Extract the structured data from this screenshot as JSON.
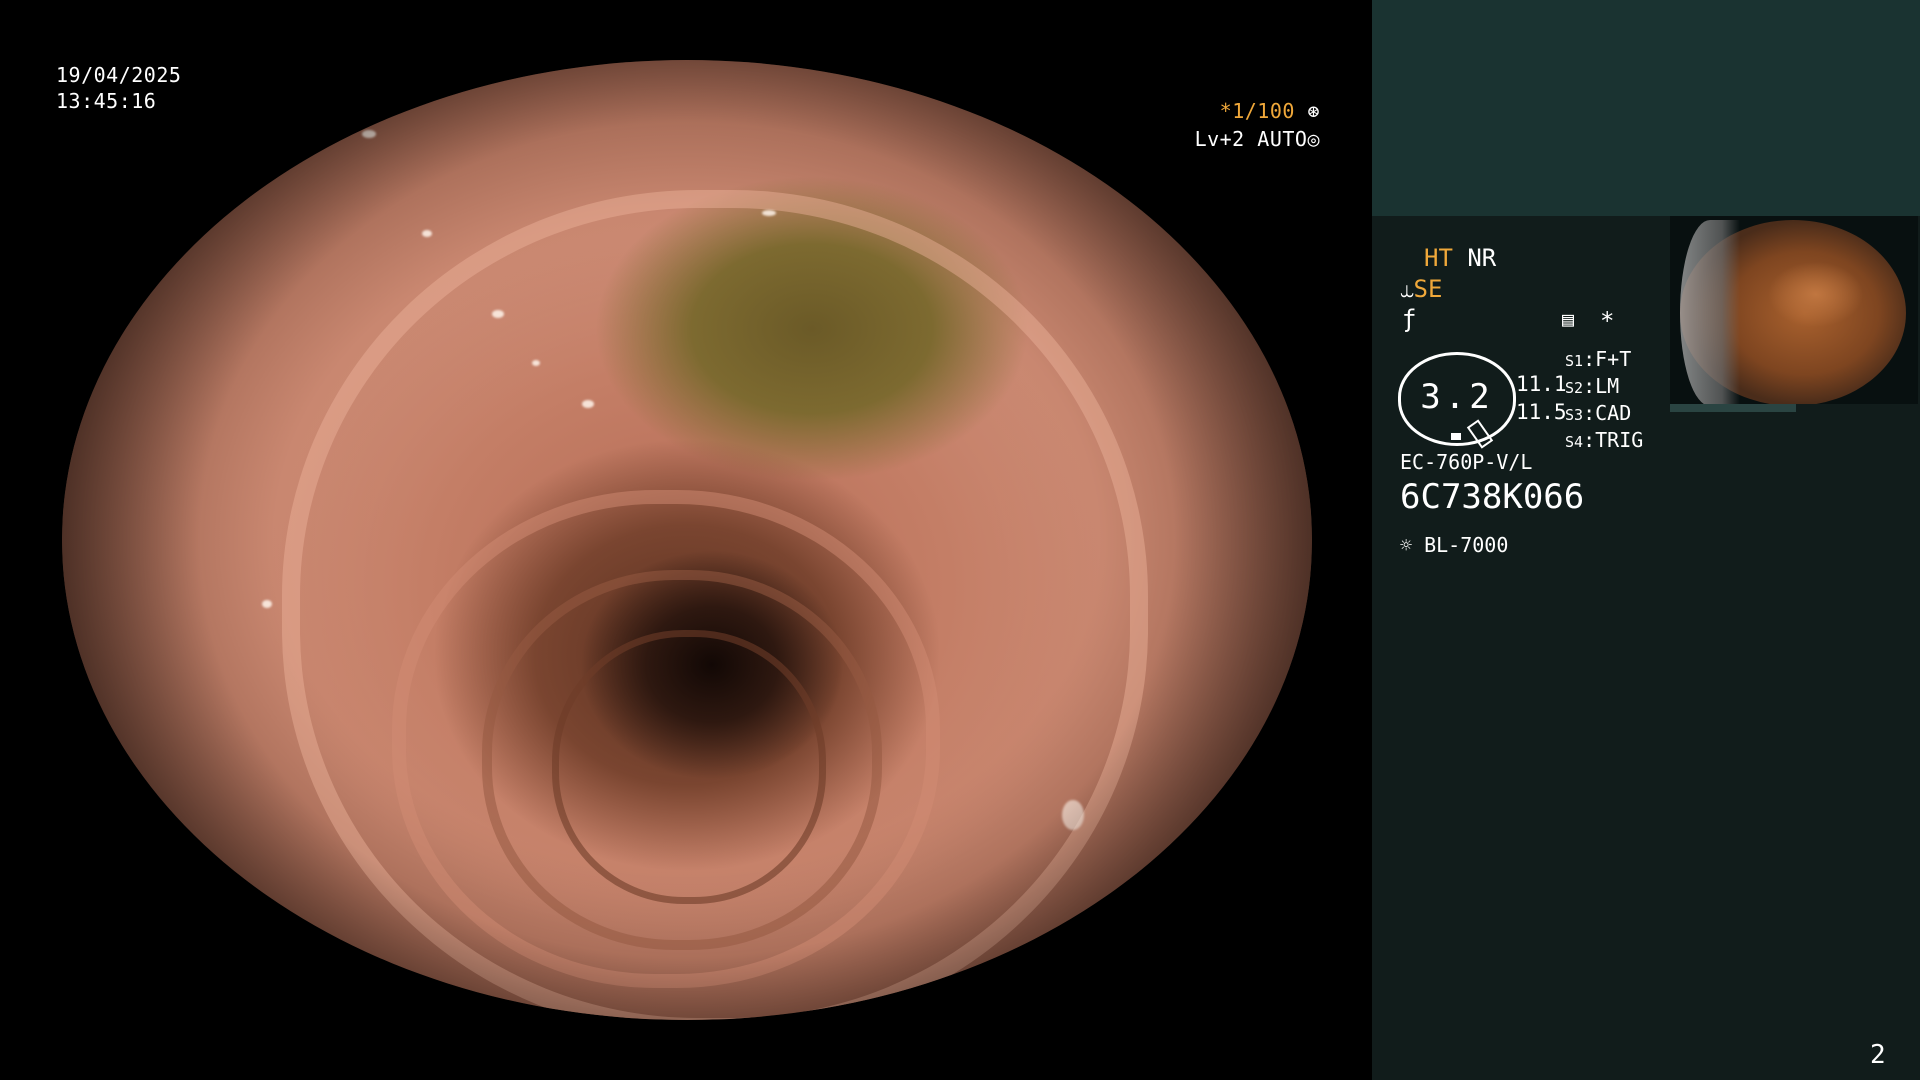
{
  "overlay": {
    "date": "19/04/2025",
    "time": "13:45:16",
    "shutter": "*1/100",
    "shutter_icon": "aperture-icon",
    "level": "Lv+2",
    "auto": "AUTO",
    "auto_icon": "iris-icon"
  },
  "side_panel": {
    "modes": {
      "ht": "HT",
      "nr": "NR",
      "se": "SE"
    },
    "freeze_icon": "freeze-icon",
    "menu_icon": "memory-icon",
    "asterisk": "*",
    "gauge_value": "3.2",
    "readings": [
      "11.1",
      "11.5"
    ],
    "switches": [
      {
        "key": "S1",
        "value": "F+T"
      },
      {
        "key": "S2",
        "value": "LM"
      },
      {
        "key": "S3",
        "value": "CAD"
      },
      {
        "key": "S4",
        "value": "TRIG"
      }
    ],
    "scope_model": "EC-760P-V/L",
    "scope_serial": "6C738K066",
    "light_source": "BL-7000",
    "light_icon": "lamp-icon"
  },
  "page_number": "2",
  "colors": {
    "accent": "#f0a83a",
    "panel": "#111c1b",
    "panel_top": "#1a3331"
  }
}
